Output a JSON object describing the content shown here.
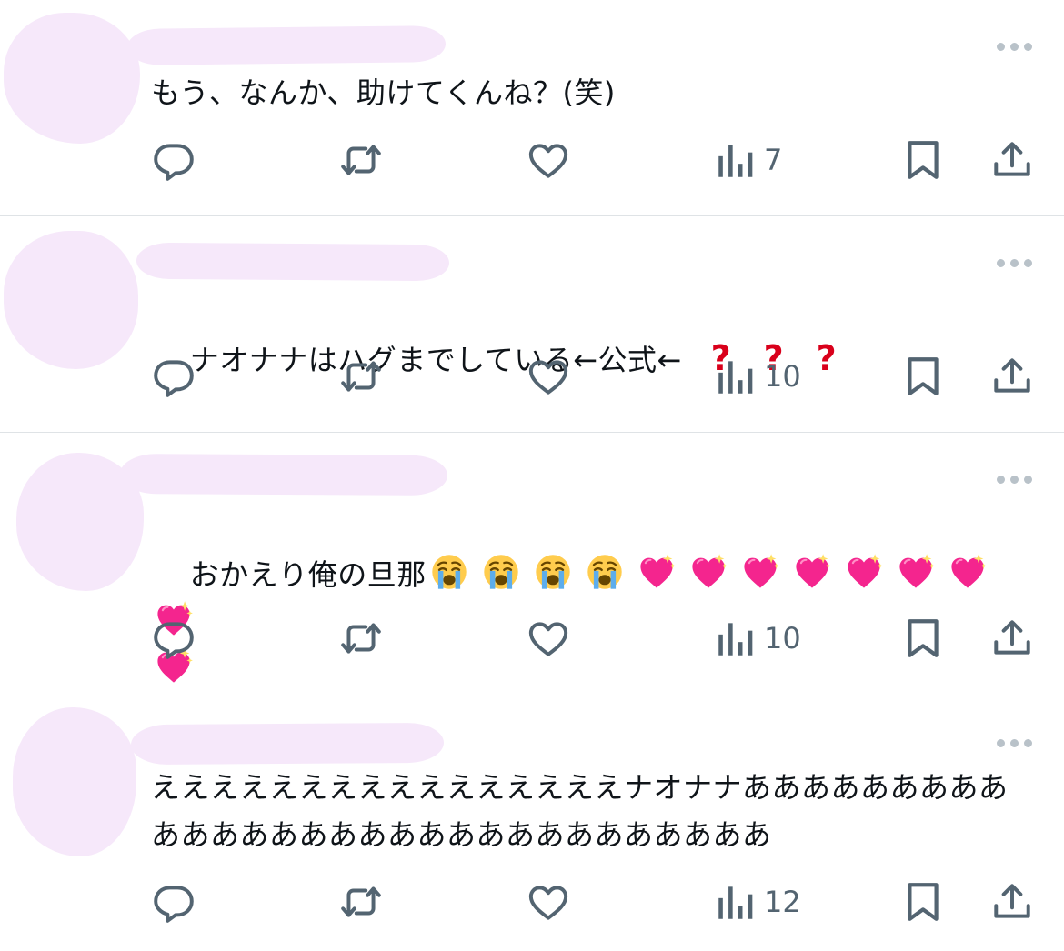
{
  "theme": {
    "text_color": "#0f1419",
    "icon_color": "#536471",
    "censor_color": "#f6e8fa",
    "divider_color": "#dfe3e6",
    "more_dots_color": "#b9c2c9",
    "question_mark_color": "#d9001b"
  },
  "icons": {
    "reply": "reply-icon",
    "retweet": "retweet-icon",
    "like": "heart-icon",
    "views": "views-chart-icon",
    "bookmark": "bookmark-icon",
    "share": "share-icon",
    "more": "more-dots-icon"
  },
  "tweets": [
    {
      "text": "もう、なんか、助けてくんね？(笑)",
      "views": "7"
    },
    {
      "text": "ナオナナはハグまでしている←公式←",
      "trailing_symbols": [
        "?",
        "?",
        "?"
      ],
      "views": "10"
    },
    {
      "text": "おかえり俺の旦那",
      "emojis": [
        "loudly-crying-face",
        "loudly-crying-face",
        "loudly-crying-face",
        "loudly-crying-face",
        "sparkling-heart",
        "sparkling-heart",
        "sparkling-heart",
        "sparkling-heart",
        "sparkling-heart",
        "sparkling-heart",
        "sparkling-heart",
        "sparkling-heart",
        "sparkling-heart"
      ],
      "views": "10"
    },
    {
      "text": "ええええええええええええええええナオナナああああああああああああああああああああああああああああああ",
      "views": "12"
    }
  ]
}
